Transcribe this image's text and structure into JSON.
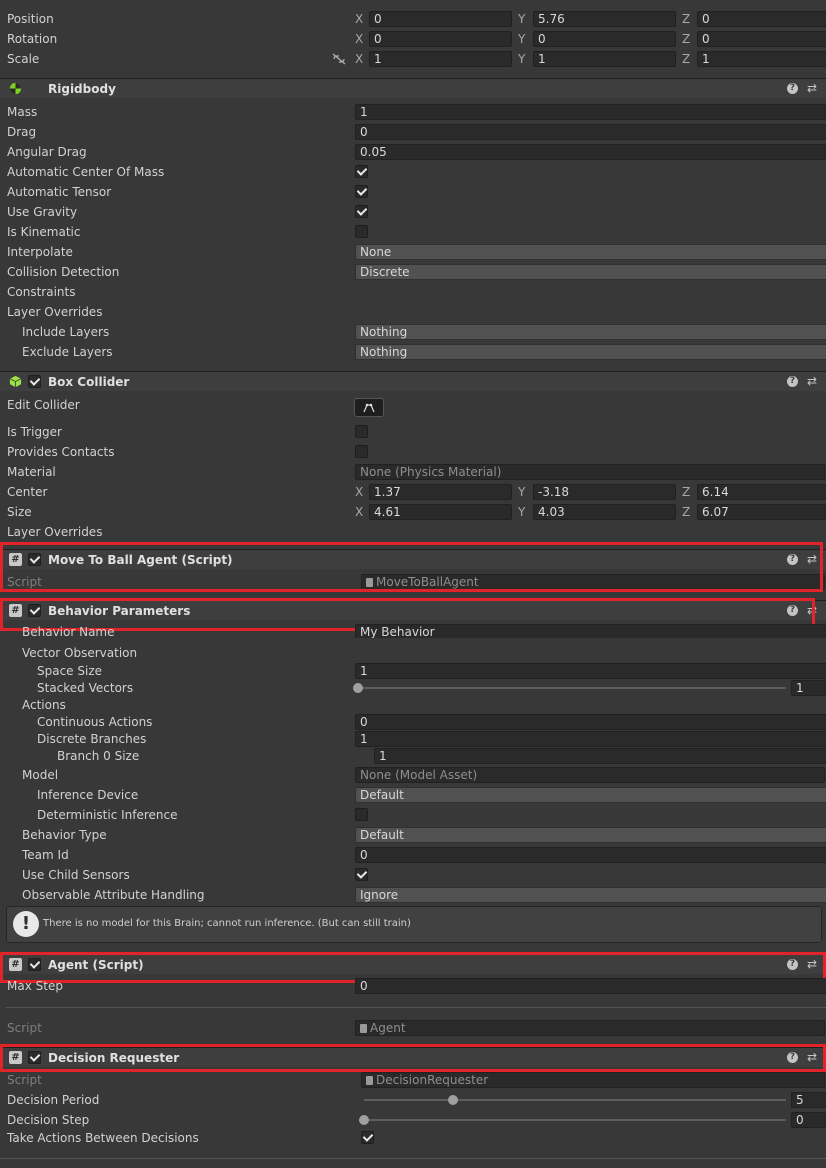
{
  "transform": {
    "position": {
      "label": "Position",
      "x": "0",
      "y": "5.76",
      "z": "0"
    },
    "rotation": {
      "label": "Rotation",
      "x": "0",
      "y": "0",
      "z": "0"
    },
    "scale": {
      "label": "Scale",
      "x": "1",
      "y": "1",
      "z": "1"
    },
    "axis_x": "X",
    "axis_y": "Y",
    "axis_z": "Z"
  },
  "rigidbody": {
    "title": "Rigidbody",
    "mass": {
      "label": "Mass",
      "value": "1"
    },
    "drag": {
      "label": "Drag",
      "value": "0"
    },
    "angular_drag": {
      "label": "Angular Drag",
      "value": "0.05"
    },
    "auto_com": {
      "label": "Automatic Center Of Mass",
      "checked": true
    },
    "auto_tensor": {
      "label": "Automatic Tensor",
      "checked": true
    },
    "use_gravity": {
      "label": "Use Gravity",
      "checked": true
    },
    "is_kinematic": {
      "label": "Is Kinematic",
      "checked": false
    },
    "interpolate": {
      "label": "Interpolate",
      "value": "None"
    },
    "collision": {
      "label": "Collision Detection",
      "value": "Discrete"
    },
    "constraints": {
      "label": "Constraints"
    },
    "layer_overrides": {
      "label": "Layer Overrides"
    },
    "include_layers": {
      "label": "Include Layers",
      "value": "Nothing"
    },
    "exclude_layers": {
      "label": "Exclude Layers",
      "value": "Nothing"
    }
  },
  "box_collider": {
    "title": "Box Collider",
    "edit_collider": {
      "label": "Edit Collider"
    },
    "is_trigger": {
      "label": "Is Trigger",
      "checked": false
    },
    "provides_contacts": {
      "label": "Provides Contacts",
      "checked": false
    },
    "material": {
      "label": "Material",
      "value": "None (Physics Material)"
    },
    "center": {
      "label": "Center",
      "x": "1.37",
      "y": "-3.18",
      "z": "6.14"
    },
    "size": {
      "label": "Size",
      "x": "4.61",
      "y": "4.03",
      "z": "6.07"
    },
    "layer_overrides": {
      "label": "Layer Overrides"
    }
  },
  "move_agent": {
    "title": "Move To Ball Agent (Script)",
    "script": {
      "label": "Script",
      "value": "MoveToBallAgent"
    }
  },
  "behavior": {
    "title": "Behavior Parameters",
    "behavior_name": {
      "label": "Behavior Name",
      "value": "My Behavior"
    },
    "vector_obs": {
      "label": "Vector Observation"
    },
    "space_size": {
      "label": "Space Size",
      "value": "1"
    },
    "stacked_vectors": {
      "label": "Stacked Vectors",
      "value": "1",
      "fraction": 0.0
    },
    "actions": {
      "label": "Actions"
    },
    "continuous": {
      "label": "Continuous Actions",
      "value": "0"
    },
    "discrete": {
      "label": "Discrete Branches",
      "value": "1"
    },
    "branch0": {
      "label": "Branch 0 Size",
      "value": "1"
    },
    "model": {
      "label": "Model",
      "value": "None (Model Asset)"
    },
    "inference_device": {
      "label": "Inference Device",
      "value": "Default"
    },
    "deterministic": {
      "label": "Deterministic Inference",
      "checked": false
    },
    "behavior_type": {
      "label": "Behavior Type",
      "value": "Default"
    },
    "team_id": {
      "label": "Team Id",
      "value": "0"
    },
    "child_sensors": {
      "label": "Use Child Sensors",
      "checked": true
    },
    "observable": {
      "label": "Observable Attribute Handling",
      "value": "Ignore"
    },
    "warning": "There is no model for this Brain; cannot run inference. (But can still train)"
  },
  "agent": {
    "title": "Agent (Script)",
    "max_step": {
      "label": "Max Step",
      "value": "0"
    },
    "script": {
      "label": "Script",
      "value": "Agent"
    }
  },
  "decision": {
    "title": "Decision Requester",
    "script": {
      "label": "Script",
      "value": "DecisionRequester"
    },
    "period": {
      "label": "Decision Period",
      "value": "5",
      "fraction": 0.21
    },
    "step": {
      "label": "Decision Step",
      "value": "0",
      "fraction": 0.0
    },
    "take_actions": {
      "label": "Take Actions Between Decisions",
      "checked": true
    }
  },
  "colors": {
    "highlight": "#e0242a",
    "rigidbody_icon": "#7ed321",
    "collider_icon": "#9fe04a"
  }
}
